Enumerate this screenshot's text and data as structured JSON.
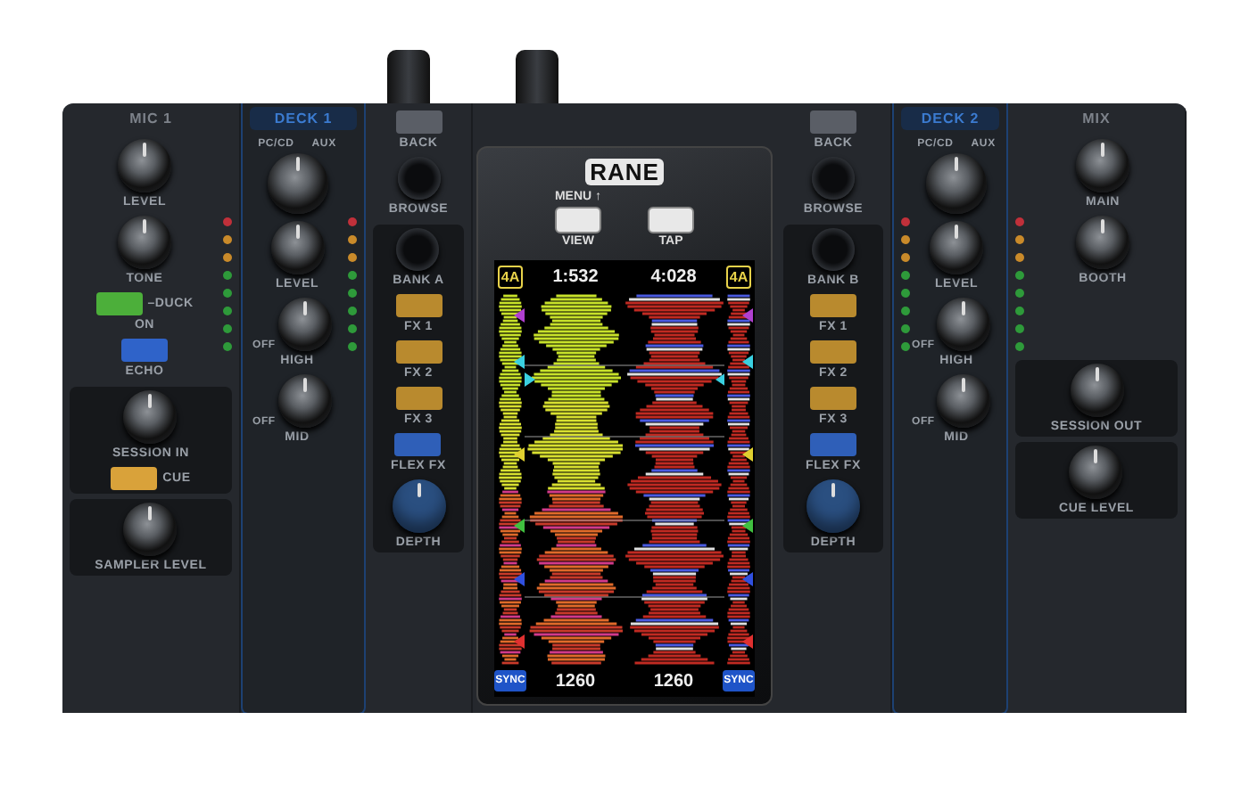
{
  "columns": [
    {
      "kind": "strip",
      "title": "MIC 1",
      "sections": [
        {
          "shaded": false,
          "meter": true,
          "controls": [
            {
              "kind": "knob",
              "label": "LEVEL"
            },
            {
              "kind": "knob",
              "label": "TONE"
            },
            {
              "kind": "pad",
              "label": "ON",
              "side_label": "–DUCK",
              "color": "#4caf3a"
            },
            {
              "kind": "pad",
              "label": "ECHO",
              "color": "#2f63c9"
            }
          ]
        },
        {
          "shaded": true,
          "meter": false,
          "controls": [
            {
              "kind": "knob",
              "label": "SESSION IN"
            },
            {
              "kind": "pad",
              "side_label": "CUE",
              "color": "#d9a23a"
            }
          ]
        },
        {
          "shaded": true,
          "meter": false,
          "controls": [
            {
              "kind": "knob",
              "label": "SAMPLER LEVEL"
            }
          ]
        }
      ]
    },
    {
      "kind": "deck",
      "title": "DECK 1",
      "sections": [
        {
          "shaded": false,
          "meter": true,
          "controls": [
            {
              "kind": "selector",
              "positions": [
                "PC/CD",
                "AUX"
              ]
            },
            {
              "kind": "knob",
              "label": "LEVEL"
            },
            {
              "kind": "knob",
              "label": "HIGH",
              "off_label": "OFF"
            },
            {
              "kind": "knob",
              "label": "MID",
              "off_label": "OFF"
            }
          ]
        }
      ]
    },
    {
      "kind": "strip",
      "sections": [
        {
          "shaded": false,
          "meter": false,
          "controls": [
            {
              "kind": "pad",
              "label": "BACK",
              "color": "#5a5e66"
            },
            {
              "kind": "encoder",
              "label": "BROWSE"
            }
          ]
        },
        {
          "shaded": true,
          "meter": false,
          "controls": [
            {
              "kind": "encoder",
              "label": "BANK A"
            },
            {
              "kind": "pad",
              "label": "FX 1",
              "color": "#b98a2e"
            },
            {
              "kind": "pad",
              "label": "FX 2",
              "color": "#b98a2e"
            },
            {
              "kind": "pad",
              "label": "FX 3",
              "color": "#b98a2e"
            },
            {
              "kind": "pad",
              "label": "FLEX FX",
              "color": "#2f5fb8"
            },
            {
              "kind": "knob",
              "label": "DEPTH",
              "color": "#2a4f80"
            }
          ]
        }
      ]
    },
    {
      "kind": "screen",
      "logo": "RANE",
      "buttons": [
        {
          "top_label": "MENU ↑",
          "label": "VIEW"
        },
        {
          "label": "TAP"
        }
      ],
      "decks": [
        {
          "key": "4A",
          "time": "1:532",
          "sync": "SYNC",
          "bpm": "1260"
        },
        {
          "key": "4A",
          "time": "4:028",
          "sync": "SYNC",
          "bpm": "1260"
        }
      ]
    },
    {
      "kind": "strip",
      "sections": [
        {
          "shaded": false,
          "meter": false,
          "controls": [
            {
              "kind": "pad",
              "label": "BACK",
              "color": "#5a5e66"
            },
            {
              "kind": "encoder",
              "label": "BROWSE"
            }
          ]
        },
        {
          "shaded": true,
          "meter": false,
          "controls": [
            {
              "kind": "encoder",
              "label": "BANK B"
            },
            {
              "kind": "pad",
              "label": "FX 1",
              "color": "#b98a2e"
            },
            {
              "kind": "pad",
              "label": "FX 2",
              "color": "#b98a2e"
            },
            {
              "kind": "pad",
              "label": "FX 3",
              "color": "#b98a2e"
            },
            {
              "kind": "pad",
              "label": "FLEX FX",
              "color": "#2f5fb8"
            },
            {
              "kind": "knob",
              "label": "DEPTH",
              "color": "#2a4f80"
            }
          ]
        }
      ]
    },
    {
      "kind": "deck",
      "title": "DECK 2",
      "sections": [
        {
          "shaded": false,
          "meter": true,
          "controls": [
            {
              "kind": "selector",
              "positions": [
                "PC/CD",
                "AUX"
              ]
            },
            {
              "kind": "knob",
              "label": "LEVEL"
            },
            {
              "kind": "knob",
              "label": "HIGH",
              "off_label": "OFF"
            },
            {
              "kind": "knob",
              "label": "MID",
              "off_label": "OFF"
            }
          ]
        }
      ]
    },
    {
      "kind": "strip",
      "title": "MIX",
      "sections": [
        {
          "shaded": false,
          "meter": true,
          "controls": [
            {
              "kind": "knob",
              "label": "MAIN"
            },
            {
              "kind": "knob",
              "label": "BOOTH"
            }
          ]
        },
        {
          "shaded": true,
          "meter": false,
          "controls": [
            {
              "kind": "knob",
              "label": "SESSION OUT"
            }
          ]
        },
        {
          "shaded": true,
          "meter": false,
          "controls": [
            {
              "kind": "knob",
              "label": "CUE LEVEL"
            }
          ]
        }
      ]
    }
  ]
}
